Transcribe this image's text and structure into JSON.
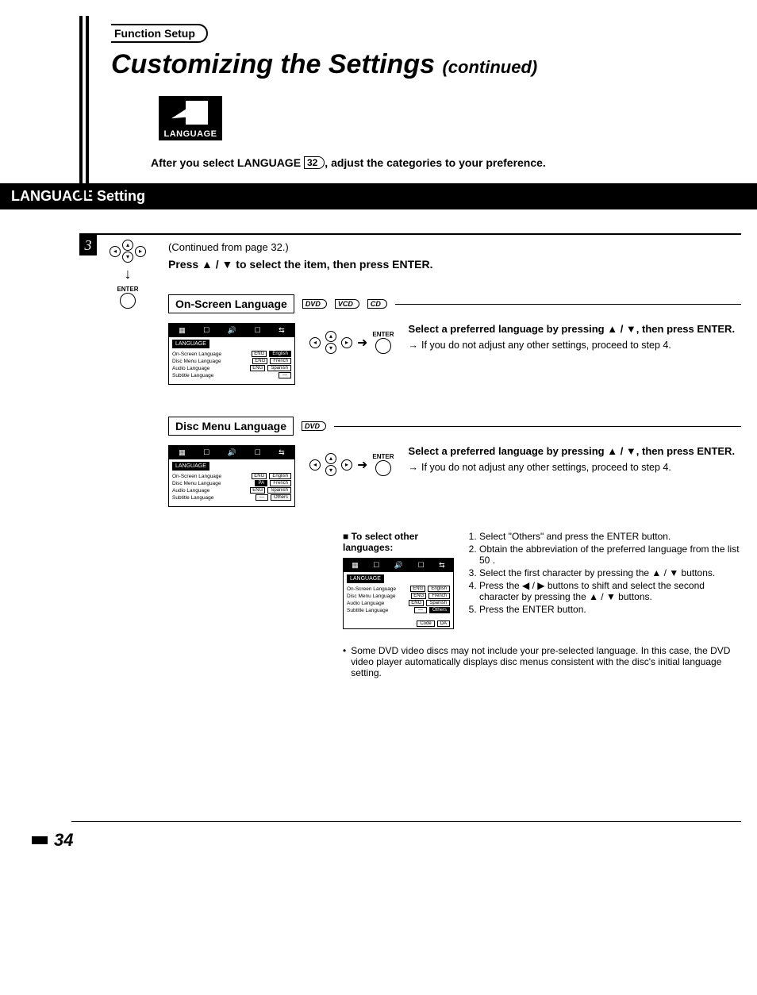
{
  "header": {
    "tab": "Function Setup",
    "title_main": "Customizing the Settings",
    "title_cont": "(continued)",
    "badge": "LANGUAGE",
    "intro_before": "After you select LANGUAGE ",
    "intro_ref": "32",
    "intro_after": ", adjust the categories to your preference."
  },
  "section_title": "LANGUAGE Setting",
  "step": {
    "num": "3",
    "enter": "ENTER",
    "continued": "(Continued from page 32.)",
    "instruction": "Press ▲ / ▼ to select the item, then press ENTER."
  },
  "osl": {
    "heading": "On-Screen Language",
    "discs": [
      "DVD",
      "VCD",
      "CD"
    ],
    "osd_title": "LANGUAGE",
    "rows": [
      {
        "label": "On-Screen Language",
        "tag": "ENG",
        "opt": "English",
        "sel": true
      },
      {
        "label": "Disc Menu Language",
        "tag": "ENG",
        "opt": "French"
      },
      {
        "label": "Audio Language",
        "tag": "ENG",
        "opt": "Spanish"
      },
      {
        "label": "Subtitle Language",
        "tag": "---",
        "opt": ""
      }
    ],
    "desc_bold": "Select a preferred language by pressing ▲ / ▼, then press ENTER.",
    "desc_sub": "If you do not adjust any other settings, proceed to step 4."
  },
  "dml": {
    "heading": "Disc Menu Language",
    "discs": [
      "DVD"
    ],
    "osd_title": "LANGUAGE",
    "rows": [
      {
        "label": "On-Screen Language",
        "tag": "ENG",
        "opt": "English"
      },
      {
        "label": "Disc Menu Language",
        "tag": "PA",
        "opt": "French",
        "dark": true
      },
      {
        "label": "Audio Language",
        "tag": "ENG",
        "opt": "Spanish"
      },
      {
        "label": "Subtitle Language",
        "tag": "---",
        "opt": "Others"
      }
    ],
    "desc_bold": "Select a preferred language by pressing ▲ / ▼, then press ENTER.",
    "desc_sub": "If you do not adjust any other settings, proceed to step 4.",
    "other_title": "To select other languages:",
    "osd2_rows": [
      {
        "label": "On-Screen Language",
        "tag": "ENG",
        "opt": "English"
      },
      {
        "label": "Disc Menu Language",
        "tag": "ENG",
        "opt": "French"
      },
      {
        "label": "Audio Language",
        "tag": "ENG",
        "opt": "Spanish"
      },
      {
        "label": "Subtitle Language",
        "tag": "---",
        "opt": "Others",
        "sel": true
      }
    ],
    "code_label": "Code",
    "code_val": "DA",
    "steps": [
      "Select \"Others\" and press the ENTER button.",
      "Obtain the abbreviation of the preferred language from the list  50 .",
      "Select the first character by pressing the ▲ / ▼ buttons.",
      "Press the ◀ / ▶ buttons to shift and select the second character by pressing the ▲ / ▼ buttons.",
      "Press the ENTER button."
    ],
    "note": "Some DVD video discs may not include your pre-selected language. In this case, the DVD video player automatically displays disc menus consistent with the disc's initial language setting."
  },
  "page_number": "34"
}
